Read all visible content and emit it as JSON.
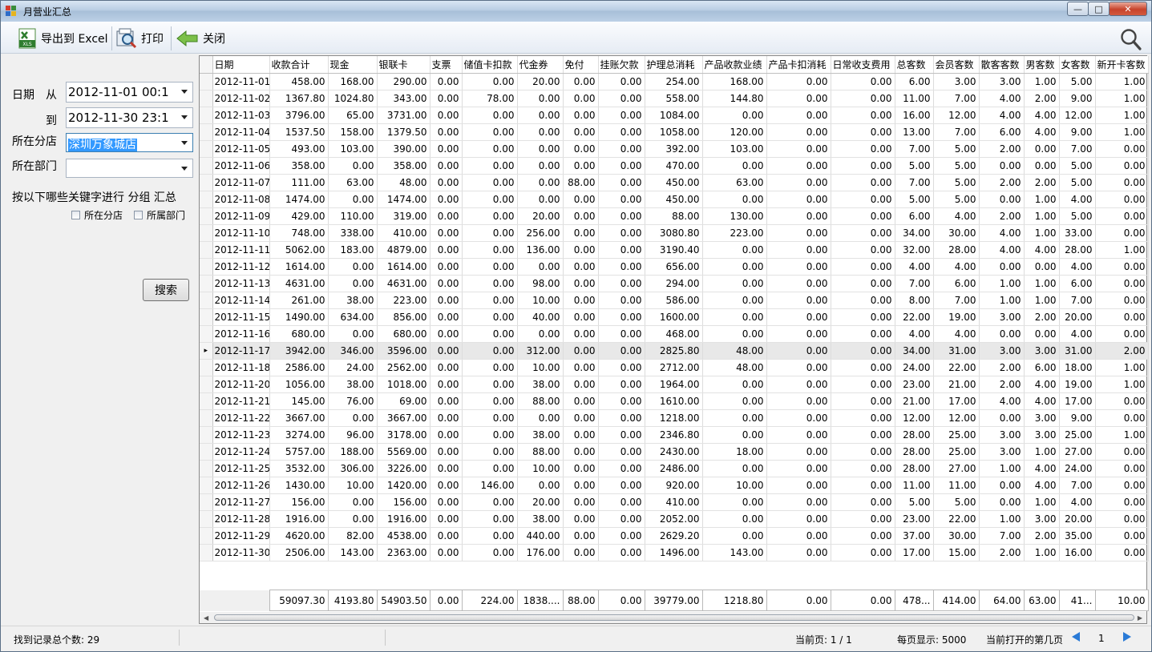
{
  "window": {
    "title": "月营业汇总"
  },
  "toolbar": {
    "export_label": "导出到 Excel",
    "print_label": "打印",
    "close_label": "关闭",
    "xls_text": "XLS"
  },
  "filters": {
    "date_label": "日期",
    "from_label": "从",
    "from_value": "2012-11-01 00:1",
    "to_label": "到",
    "to_value": "2012-11-30 23:1",
    "branch_label": "所在分店",
    "branch_value": "深圳万象城店",
    "dept_label": "所在部门",
    "dept_value": "",
    "group_label": "按以下哪些关键字进行  分组  汇总",
    "chk_branch": "所在分店",
    "chk_dept": "所属部门",
    "search_button": "搜索"
  },
  "grid": {
    "columns": [
      "日期",
      "收款合计",
      "现金",
      "银联卡",
      "支票",
      "储值卡扣款",
      "代金券",
      "免付",
      "挂账欠款",
      "护理总消耗",
      "产品收款业绩",
      "产品卡扣消耗",
      "日常收支费用",
      "总客数",
      "会员客数",
      "散客客数",
      "男客数",
      "女客数",
      "新开卡客数"
    ],
    "current_row_index": 16,
    "rows": [
      [
        "2012-11-01",
        "458.00",
        "168.00",
        "290.00",
        "0.00",
        "0.00",
        "20.00",
        "0.00",
        "0.00",
        "254.00",
        "168.00",
        "0.00",
        "0.00",
        "6.00",
        "3.00",
        "3.00",
        "1.00",
        "5.00",
        "1.00"
      ],
      [
        "2012-11-02",
        "1367.80",
        "1024.80",
        "343.00",
        "0.00",
        "78.00",
        "0.00",
        "0.00",
        "0.00",
        "558.00",
        "144.80",
        "0.00",
        "0.00",
        "11.00",
        "7.00",
        "4.00",
        "2.00",
        "9.00",
        "1.00"
      ],
      [
        "2012-11-03",
        "3796.00",
        "65.00",
        "3731.00",
        "0.00",
        "0.00",
        "0.00",
        "0.00",
        "0.00",
        "1084.00",
        "0.00",
        "0.00",
        "0.00",
        "16.00",
        "12.00",
        "4.00",
        "4.00",
        "12.00",
        "1.00"
      ],
      [
        "2012-11-04",
        "1537.50",
        "158.00",
        "1379.50",
        "0.00",
        "0.00",
        "0.00",
        "0.00",
        "0.00",
        "1058.00",
        "120.00",
        "0.00",
        "0.00",
        "13.00",
        "7.00",
        "6.00",
        "4.00",
        "9.00",
        "1.00"
      ],
      [
        "2012-11-05",
        "493.00",
        "103.00",
        "390.00",
        "0.00",
        "0.00",
        "0.00",
        "0.00",
        "0.00",
        "392.00",
        "103.00",
        "0.00",
        "0.00",
        "7.00",
        "5.00",
        "2.00",
        "0.00",
        "7.00",
        "0.00"
      ],
      [
        "2012-11-06",
        "358.00",
        "0.00",
        "358.00",
        "0.00",
        "0.00",
        "0.00",
        "0.00",
        "0.00",
        "470.00",
        "0.00",
        "0.00",
        "0.00",
        "5.00",
        "5.00",
        "0.00",
        "0.00",
        "5.00",
        "0.00"
      ],
      [
        "2012-11-07",
        "111.00",
        "63.00",
        "48.00",
        "0.00",
        "0.00",
        "0.00",
        "88.00",
        "0.00",
        "450.00",
        "63.00",
        "0.00",
        "0.00",
        "7.00",
        "5.00",
        "2.00",
        "2.00",
        "5.00",
        "0.00"
      ],
      [
        "2012-11-08",
        "1474.00",
        "0.00",
        "1474.00",
        "0.00",
        "0.00",
        "0.00",
        "0.00",
        "0.00",
        "450.00",
        "0.00",
        "0.00",
        "0.00",
        "5.00",
        "5.00",
        "0.00",
        "1.00",
        "4.00",
        "0.00"
      ],
      [
        "2012-11-09",
        "429.00",
        "110.00",
        "319.00",
        "0.00",
        "0.00",
        "20.00",
        "0.00",
        "0.00",
        "88.00",
        "130.00",
        "0.00",
        "0.00",
        "6.00",
        "4.00",
        "2.00",
        "1.00",
        "5.00",
        "0.00"
      ],
      [
        "2012-11-10",
        "748.00",
        "338.00",
        "410.00",
        "0.00",
        "0.00",
        "256.00",
        "0.00",
        "0.00",
        "3080.80",
        "223.00",
        "0.00",
        "0.00",
        "34.00",
        "30.00",
        "4.00",
        "1.00",
        "33.00",
        "0.00"
      ],
      [
        "2012-11-11",
        "5062.00",
        "183.00",
        "4879.00",
        "0.00",
        "0.00",
        "136.00",
        "0.00",
        "0.00",
        "3190.40",
        "0.00",
        "0.00",
        "0.00",
        "32.00",
        "28.00",
        "4.00",
        "4.00",
        "28.00",
        "1.00"
      ],
      [
        "2012-11-12",
        "1614.00",
        "0.00",
        "1614.00",
        "0.00",
        "0.00",
        "0.00",
        "0.00",
        "0.00",
        "656.00",
        "0.00",
        "0.00",
        "0.00",
        "4.00",
        "4.00",
        "0.00",
        "0.00",
        "4.00",
        "0.00"
      ],
      [
        "2012-11-13",
        "4631.00",
        "0.00",
        "4631.00",
        "0.00",
        "0.00",
        "98.00",
        "0.00",
        "0.00",
        "294.00",
        "0.00",
        "0.00",
        "0.00",
        "7.00",
        "6.00",
        "1.00",
        "1.00",
        "6.00",
        "0.00"
      ],
      [
        "2012-11-14",
        "261.00",
        "38.00",
        "223.00",
        "0.00",
        "0.00",
        "10.00",
        "0.00",
        "0.00",
        "586.00",
        "0.00",
        "0.00",
        "0.00",
        "8.00",
        "7.00",
        "1.00",
        "1.00",
        "7.00",
        "0.00"
      ],
      [
        "2012-11-15",
        "1490.00",
        "634.00",
        "856.00",
        "0.00",
        "0.00",
        "40.00",
        "0.00",
        "0.00",
        "1600.00",
        "0.00",
        "0.00",
        "0.00",
        "22.00",
        "19.00",
        "3.00",
        "2.00",
        "20.00",
        "0.00"
      ],
      [
        "2012-11-16",
        "680.00",
        "0.00",
        "680.00",
        "0.00",
        "0.00",
        "0.00",
        "0.00",
        "0.00",
        "468.00",
        "0.00",
        "0.00",
        "0.00",
        "4.00",
        "4.00",
        "0.00",
        "0.00",
        "4.00",
        "0.00"
      ],
      [
        "2012-11-17",
        "3942.00",
        "346.00",
        "3596.00",
        "0.00",
        "0.00",
        "312.00",
        "0.00",
        "0.00",
        "2825.80",
        "48.00",
        "0.00",
        "0.00",
        "34.00",
        "31.00",
        "3.00",
        "3.00",
        "31.00",
        "2.00"
      ],
      [
        "2012-11-18",
        "2586.00",
        "24.00",
        "2562.00",
        "0.00",
        "0.00",
        "10.00",
        "0.00",
        "0.00",
        "2712.00",
        "48.00",
        "0.00",
        "0.00",
        "24.00",
        "22.00",
        "2.00",
        "6.00",
        "18.00",
        "1.00"
      ],
      [
        "2012-11-20",
        "1056.00",
        "38.00",
        "1018.00",
        "0.00",
        "0.00",
        "38.00",
        "0.00",
        "0.00",
        "1964.00",
        "0.00",
        "0.00",
        "0.00",
        "23.00",
        "21.00",
        "2.00",
        "4.00",
        "19.00",
        "1.00"
      ],
      [
        "2012-11-21",
        "145.00",
        "76.00",
        "69.00",
        "0.00",
        "0.00",
        "88.00",
        "0.00",
        "0.00",
        "1610.00",
        "0.00",
        "0.00",
        "0.00",
        "21.00",
        "17.00",
        "4.00",
        "4.00",
        "17.00",
        "0.00"
      ],
      [
        "2012-11-22",
        "3667.00",
        "0.00",
        "3667.00",
        "0.00",
        "0.00",
        "0.00",
        "0.00",
        "0.00",
        "1218.00",
        "0.00",
        "0.00",
        "0.00",
        "12.00",
        "12.00",
        "0.00",
        "3.00",
        "9.00",
        "0.00"
      ],
      [
        "2012-11-23",
        "3274.00",
        "96.00",
        "3178.00",
        "0.00",
        "0.00",
        "38.00",
        "0.00",
        "0.00",
        "2346.80",
        "0.00",
        "0.00",
        "0.00",
        "28.00",
        "25.00",
        "3.00",
        "3.00",
        "25.00",
        "1.00"
      ],
      [
        "2012-11-24",
        "5757.00",
        "188.00",
        "5569.00",
        "0.00",
        "0.00",
        "88.00",
        "0.00",
        "0.00",
        "2430.00",
        "18.00",
        "0.00",
        "0.00",
        "28.00",
        "25.00",
        "3.00",
        "1.00",
        "27.00",
        "0.00"
      ],
      [
        "2012-11-25",
        "3532.00",
        "306.00",
        "3226.00",
        "0.00",
        "0.00",
        "10.00",
        "0.00",
        "0.00",
        "2486.00",
        "0.00",
        "0.00",
        "0.00",
        "28.00",
        "27.00",
        "1.00",
        "4.00",
        "24.00",
        "0.00"
      ],
      [
        "2012-11-26",
        "1430.00",
        "10.00",
        "1420.00",
        "0.00",
        "146.00",
        "0.00",
        "0.00",
        "0.00",
        "920.00",
        "10.00",
        "0.00",
        "0.00",
        "11.00",
        "11.00",
        "0.00",
        "4.00",
        "7.00",
        "0.00"
      ],
      [
        "2012-11-27",
        "156.00",
        "0.00",
        "156.00",
        "0.00",
        "0.00",
        "20.00",
        "0.00",
        "0.00",
        "410.00",
        "0.00",
        "0.00",
        "0.00",
        "5.00",
        "5.00",
        "0.00",
        "1.00",
        "4.00",
        "0.00"
      ],
      [
        "2012-11-28",
        "1916.00",
        "0.00",
        "1916.00",
        "0.00",
        "0.00",
        "38.00",
        "0.00",
        "0.00",
        "2052.00",
        "0.00",
        "0.00",
        "0.00",
        "23.00",
        "22.00",
        "1.00",
        "3.00",
        "20.00",
        "0.00"
      ],
      [
        "2012-11-29",
        "4620.00",
        "82.00",
        "4538.00",
        "0.00",
        "0.00",
        "440.00",
        "0.00",
        "0.00",
        "2629.20",
        "0.00",
        "0.00",
        "0.00",
        "37.00",
        "30.00",
        "7.00",
        "2.00",
        "35.00",
        "0.00"
      ],
      [
        "2012-11-30",
        "2506.00",
        "143.00",
        "2363.00",
        "0.00",
        "0.00",
        "176.00",
        "0.00",
        "0.00",
        "1496.00",
        "143.00",
        "0.00",
        "0.00",
        "17.00",
        "15.00",
        "2.00",
        "1.00",
        "16.00",
        "0.00"
      ]
    ],
    "totals": [
      "",
      "59097.30",
      "4193.80",
      "54903.50",
      "0.00",
      "224.00",
      "1838....",
      "88.00",
      "0.00",
      "39779.00",
      "1218.80",
      "0.00",
      "0.00",
      "478...",
      "414.00",
      "64.00",
      "63.00",
      "41...",
      "10.00"
    ]
  },
  "status": {
    "record_count": "找到记录总个数: 29",
    "current_page": "当前页: 1 / 1",
    "per_page": "每页显示: 5000",
    "open_page_label": "当前打开的第几页",
    "page_number": "1"
  }
}
